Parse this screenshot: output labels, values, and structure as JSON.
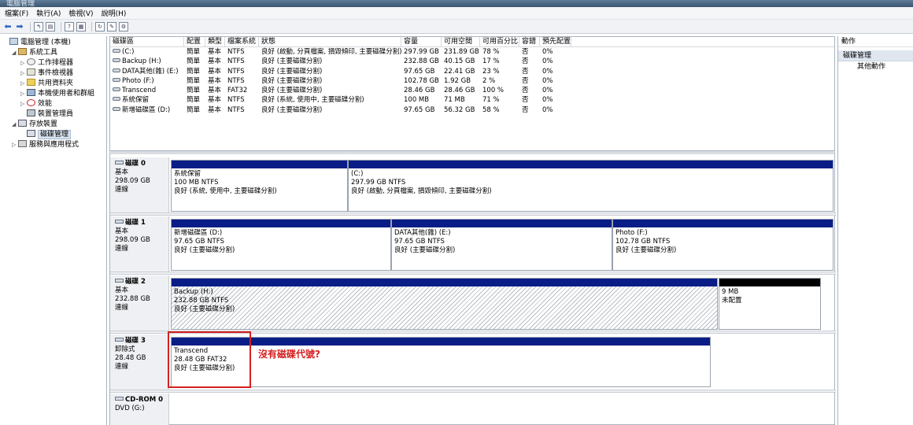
{
  "window": {
    "title": "電腦管理"
  },
  "menu": [
    "檔案(F)",
    "執行(A)",
    "檢視(V)",
    "說明(H)"
  ],
  "tree": [
    {
      "label": "電腦管理 (本機)",
      "level": 0,
      "exp": "",
      "icon": "ic-comp",
      "iconName": "computer-management-icon"
    },
    {
      "label": "系統工具",
      "level": 1,
      "exp": "◢",
      "icon": "ic-tool",
      "iconName": "system-tools-icon"
    },
    {
      "label": "工作排程器",
      "level": 2,
      "exp": "▷",
      "icon": "ic-clock",
      "iconName": "task-scheduler-icon"
    },
    {
      "label": "事件檢視器",
      "level": 2,
      "exp": "▷",
      "icon": "ic-log",
      "iconName": "event-viewer-icon"
    },
    {
      "label": "共用資料夾",
      "level": 2,
      "exp": "▷",
      "icon": "ic-folder",
      "iconName": "shared-folder-icon"
    },
    {
      "label": "本機使用者和群組",
      "level": 2,
      "exp": "▷",
      "icon": "ic-users",
      "iconName": "local-users-icon"
    },
    {
      "label": "效能",
      "level": 2,
      "exp": "▷",
      "icon": "ic-perf",
      "iconName": "performance-icon"
    },
    {
      "label": "裝置管理員",
      "level": 2,
      "exp": "",
      "icon": "ic-dev",
      "iconName": "device-manager-icon"
    },
    {
      "label": "存放裝置",
      "level": 1,
      "exp": "◢",
      "icon": "ic-disk",
      "iconName": "storage-icon"
    },
    {
      "label": "磁碟管理",
      "level": 2,
      "exp": "",
      "icon": "ic-disk",
      "iconName": "disk-management-icon",
      "selected": true
    },
    {
      "label": "服務與應用程式",
      "level": 1,
      "exp": "▷",
      "icon": "ic-svc",
      "iconName": "services-apps-icon"
    }
  ],
  "volumes": {
    "headers": [
      "磁碟區",
      "配置",
      "類型",
      "檔案系統",
      "狀態",
      "容量",
      "可用空間",
      "可用百分比",
      "容錯",
      "預先配置"
    ],
    "rows": [
      [
        "(C:)",
        "簡單",
        "基本",
        "NTFS",
        "良好 (啟動, 分頁檔案, 損毀傾印, 主要磁碟分割)",
        "297.99 GB",
        "231.89 GB",
        "78 %",
        "否",
        "0%"
      ],
      [
        "Backup (H:)",
        "簡單",
        "基本",
        "NTFS",
        "良好 (主要磁碟分割)",
        "232.88 GB",
        "40.15 GB",
        "17 %",
        "否",
        "0%"
      ],
      [
        "DATA其他(雜) (E:)",
        "簡單",
        "基本",
        "NTFS",
        "良好 (主要磁碟分割)",
        "97.65 GB",
        "22.41 GB",
        "23 %",
        "否",
        "0%"
      ],
      [
        "Photo (F:)",
        "簡單",
        "基本",
        "NTFS",
        "良好 (主要磁碟分割)",
        "102.78 GB",
        "1.92 GB",
        "2 %",
        "否",
        "0%"
      ],
      [
        "Transcend",
        "簡單",
        "基本",
        "FAT32",
        "良好 (主要磁碟分割)",
        "28.46 GB",
        "28.46 GB",
        "100 %",
        "否",
        "0%"
      ],
      [
        "系統保留",
        "簡單",
        "基本",
        "NTFS",
        "良好 (系統, 使用中, 主要磁碟分割)",
        "100 MB",
        "71 MB",
        "71 %",
        "否",
        "0%"
      ],
      [
        "新增磁碟區 (D:)",
        "簡單",
        "基本",
        "NTFS",
        "良好 (主要磁碟分割)",
        "97.65 GB",
        "56.32 GB",
        "58 %",
        "否",
        "0%"
      ]
    ]
  },
  "disks": [
    {
      "name": "磁碟 0",
      "type": "基本",
      "size": "298.09 GB",
      "status": "連線",
      "partitions": [
        {
          "name": "系統保留",
          "info": "100 MB NTFS",
          "status": "良好 (系統, 使用中, 主要磁碟分割)"
        },
        {
          "name": "(C:)",
          "info": "297.99 GB NTFS",
          "status": "良好 (啟動, 分頁檔案, 損毀傾印, 主要磁碟分割)"
        }
      ]
    },
    {
      "name": "磁碟 1",
      "type": "基本",
      "size": "298.09 GB",
      "status": "連線",
      "partitions": [
        {
          "name": "新增磁碟區 (D:)",
          "info": "97.65 GB NTFS",
          "status": "良好 (主要磁碟分割)"
        },
        {
          "name": "DATA其他(雜) (E:)",
          "info": "97.65 GB NTFS",
          "status": "良好 (主要磁碟分割)"
        },
        {
          "name": "Photo (F:)",
          "info": "102.78 GB NTFS",
          "status": "良好 (主要磁碟分割)"
        }
      ]
    },
    {
      "name": "磁碟 2",
      "type": "基本",
      "size": "232.88 GB",
      "status": "連線",
      "partitions": [
        {
          "name": "Backup (H:)",
          "info": "232.88 GB NTFS",
          "status": "良好 (主要磁碟分割)"
        },
        {
          "name": "",
          "info": "9 MB",
          "status": "未配置"
        }
      ]
    },
    {
      "name": "磁碟 3",
      "type": "卸除式",
      "size": "28.48 GB",
      "status": "連線",
      "partitions": [
        {
          "name": "Transcend",
          "info": "28.48 GB FAT32",
          "status": "良好 (主要磁碟分割)"
        }
      ]
    },
    {
      "name": "CD-ROM 0",
      "type": "DVD (G:)",
      "size": "",
      "status": "",
      "partitions": []
    }
  ],
  "annotation": "沒有磁碟代號?",
  "actions": {
    "header": "動作",
    "section": "磁碟管理",
    "item": "其他動作"
  },
  "colors": {
    "partition_bar": "#0a1d86",
    "unallocated_bar": "#000000",
    "annotation": "#d62020"
  }
}
